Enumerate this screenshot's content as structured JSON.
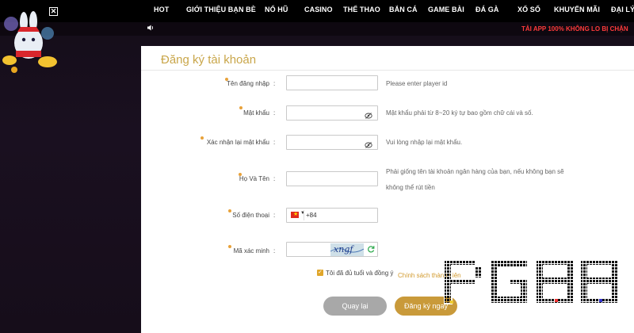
{
  "nav": {
    "items": [
      "HOT",
      "GIỚI THIỆU BẠN BÈ",
      "NỔ HŨ",
      "CASINO",
      "THỂ THAO",
      "BẮN CÁ",
      "GAME BÀI",
      "ĐÁ GÀ",
      "XỔ SỐ",
      "KHUYẾN MÃI",
      "ĐẠI LÝ"
    ],
    "close_label": "✕"
  },
  "marquee": {
    "speaker_icon": "speaker-icon",
    "text": "TẢI APP 100% KHÔNG LO BỊ CHẶN"
  },
  "form": {
    "title": "Đăng ký tài khoản",
    "fields": [
      {
        "label": "Tên đăng nhập",
        "value": "",
        "hint": "Please enter player id"
      },
      {
        "label": "Mật khẩu",
        "value": "",
        "hint": "Mật khẩu phải từ 8~20 ký tự bao gồm chữ cái và số."
      },
      {
        "label": "Xác nhận lại mật khẩu",
        "value": "",
        "hint": "Vui lòng nhập lại mật khẩu."
      },
      {
        "label": "Họ Và Tên",
        "value": "",
        "hint_line1": "Phải giống tên tài khoản ngân hàng của bạn, nếu không bạn sẽ",
        "hint_line2": "không thể rút tiền"
      },
      {
        "label": "Số điện thoại",
        "value": "+84"
      },
      {
        "label": "Mã xác minh",
        "value": "",
        "captcha": "xngf"
      }
    ],
    "colon": ":",
    "agree_text": "Tôi đã đủ tuổi và đồng ý",
    "policy_link": "Chính sách thành viên",
    "back_button": "Quay lại",
    "register_button": "Đăng ký ngay"
  },
  "brand": {
    "logo_text": "PG88",
    "accent": "#c9a64a",
    "required_dot": "#e8a23a"
  }
}
